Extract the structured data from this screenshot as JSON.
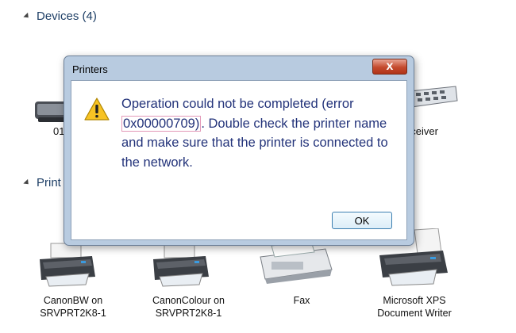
{
  "groups": {
    "devices": "Devices (4)",
    "printers_fragment": "Print"
  },
  "partial_labels": {
    "left": "01",
    "right": "eceiver"
  },
  "printers": [
    {
      "line1": "CanonBW on",
      "line2": "SRVPRT2K8-1"
    },
    {
      "line1": "CanonColour on",
      "line2": "SRVPRT2K8-1"
    },
    {
      "line1": "Fax",
      "line2": ""
    },
    {
      "line1": "Microsoft XPS",
      "line2": "Document Writer"
    }
  ],
  "dialog": {
    "title": "Printers",
    "close_glyph": "x",
    "message_before": "Operation could not be completed (error ",
    "error_code": "0x00000709)",
    "message_after": ". Double check the printer name and make sure that the printer is connected to the network.",
    "ok_label": "OK",
    "icon": "warning-icon",
    "highlight_color": "#e399b8"
  }
}
